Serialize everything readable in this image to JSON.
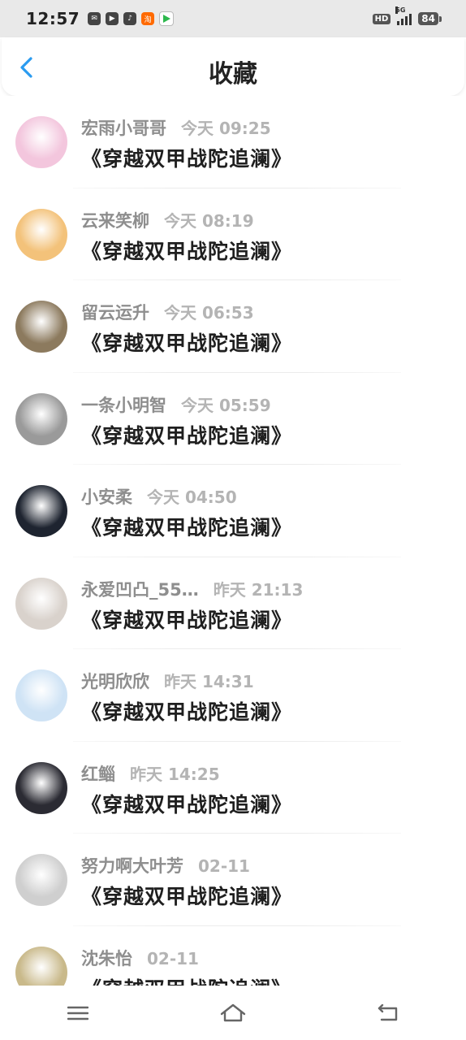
{
  "status": {
    "time": "12:57",
    "notification_icons": [
      "message-icon",
      "video-icon",
      "tiktok-icon",
      "taobao-icon",
      "play-icon"
    ],
    "hd": "HD",
    "network": "5G",
    "battery": "84"
  },
  "header": {
    "title": "收藏",
    "back_icon": "chevron-left-icon",
    "accent": "#2a9bf0"
  },
  "list": [
    {
      "name": "宏雨小哥哥",
      "time": "今天 09:25",
      "book": "《穿越双甲战陀追澜》",
      "avatar": "#f3c6dd"
    },
    {
      "name": "云来笑柳",
      "time": "今天 08:19",
      "book": "《穿越双甲战陀追澜》",
      "avatar": "#f3c27a"
    },
    {
      "name": "留云运升",
      "time": "今天 06:53",
      "book": "《穿越双甲战陀追澜》",
      "avatar": "#8c7a5e"
    },
    {
      "name": "一条小明智",
      "time": "今天 05:59",
      "book": "《穿越双甲战陀追澜》",
      "avatar": "#9a9a9a"
    },
    {
      "name": "小安柔",
      "time": "今天 04:50",
      "book": "《穿越双甲战陀追澜》",
      "avatar": "#1e2430"
    },
    {
      "name": "永爱凹凸_55…",
      "time": "昨天 21:13",
      "book": "《穿越双甲战陀追澜》",
      "avatar": "#d9d2cc"
    },
    {
      "name": "光明欣欣",
      "time": "昨天 14:31",
      "book": "《穿越双甲战陀追澜》",
      "avatar": "#cfe3f5"
    },
    {
      "name": "红鲻",
      "time": "昨天 14:25",
      "book": "《穿越双甲战陀追澜》",
      "avatar": "#2b2b33"
    },
    {
      "name": "努力啊大叶芳",
      "time": "02-11",
      "book": "《穿越双甲战陀追澜》",
      "avatar": "#cfcfcf"
    },
    {
      "name": "沈朱怡",
      "time": "02-11",
      "book": "《穿越双甲战陀追澜》",
      "avatar": "#c9b98a"
    }
  ],
  "navbar": {
    "icons": [
      "menu-icon",
      "home-icon",
      "back-nav-icon"
    ]
  }
}
